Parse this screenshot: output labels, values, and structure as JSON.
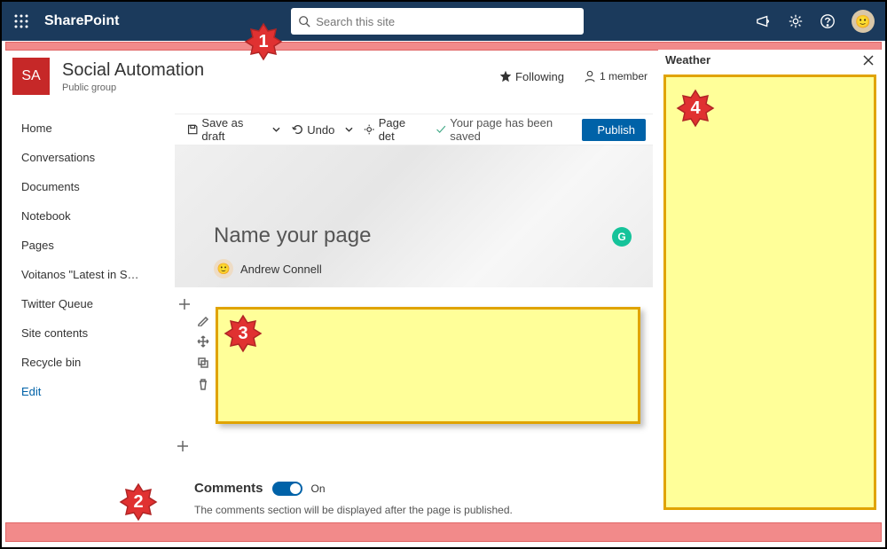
{
  "brand": "SharePoint",
  "search": {
    "placeholder": "Search this site"
  },
  "site": {
    "logo": "SA",
    "title": "Social Automation",
    "subtitle": "Public group",
    "following_label": "Following",
    "members_label": "1 member"
  },
  "nav": {
    "items": [
      {
        "label": "Home"
      },
      {
        "label": "Conversations"
      },
      {
        "label": "Documents"
      },
      {
        "label": "Notebook"
      },
      {
        "label": "Pages"
      },
      {
        "label": "Voitanos \"Latest in SP D..."
      },
      {
        "label": "Twitter Queue"
      },
      {
        "label": "Site contents"
      },
      {
        "label": "Recycle bin"
      }
    ],
    "edit_label": "Edit"
  },
  "toolbar": {
    "save_label": "Save as draft",
    "undo_label": "Undo",
    "pagedet_label": "Page det",
    "saved_label": "Your page has been saved",
    "publish_label": "Publish"
  },
  "page": {
    "title_placeholder": "Name your page",
    "author": "Andrew Connell"
  },
  "comments": {
    "heading": "Comments",
    "state": "On",
    "note": "The comments section will be displayed after the page is published."
  },
  "pane": {
    "title": "Weather"
  },
  "callouts": {
    "c1": "1",
    "c2": "2",
    "c3": "3",
    "c4": "4"
  },
  "colors": {
    "accent": "#0062a8",
    "topbar": "#1b3a5c",
    "highlight": "#ffff99",
    "highlight_border": "#e0a300",
    "red_bar": "#f28a8a",
    "callout": "#e03131"
  }
}
